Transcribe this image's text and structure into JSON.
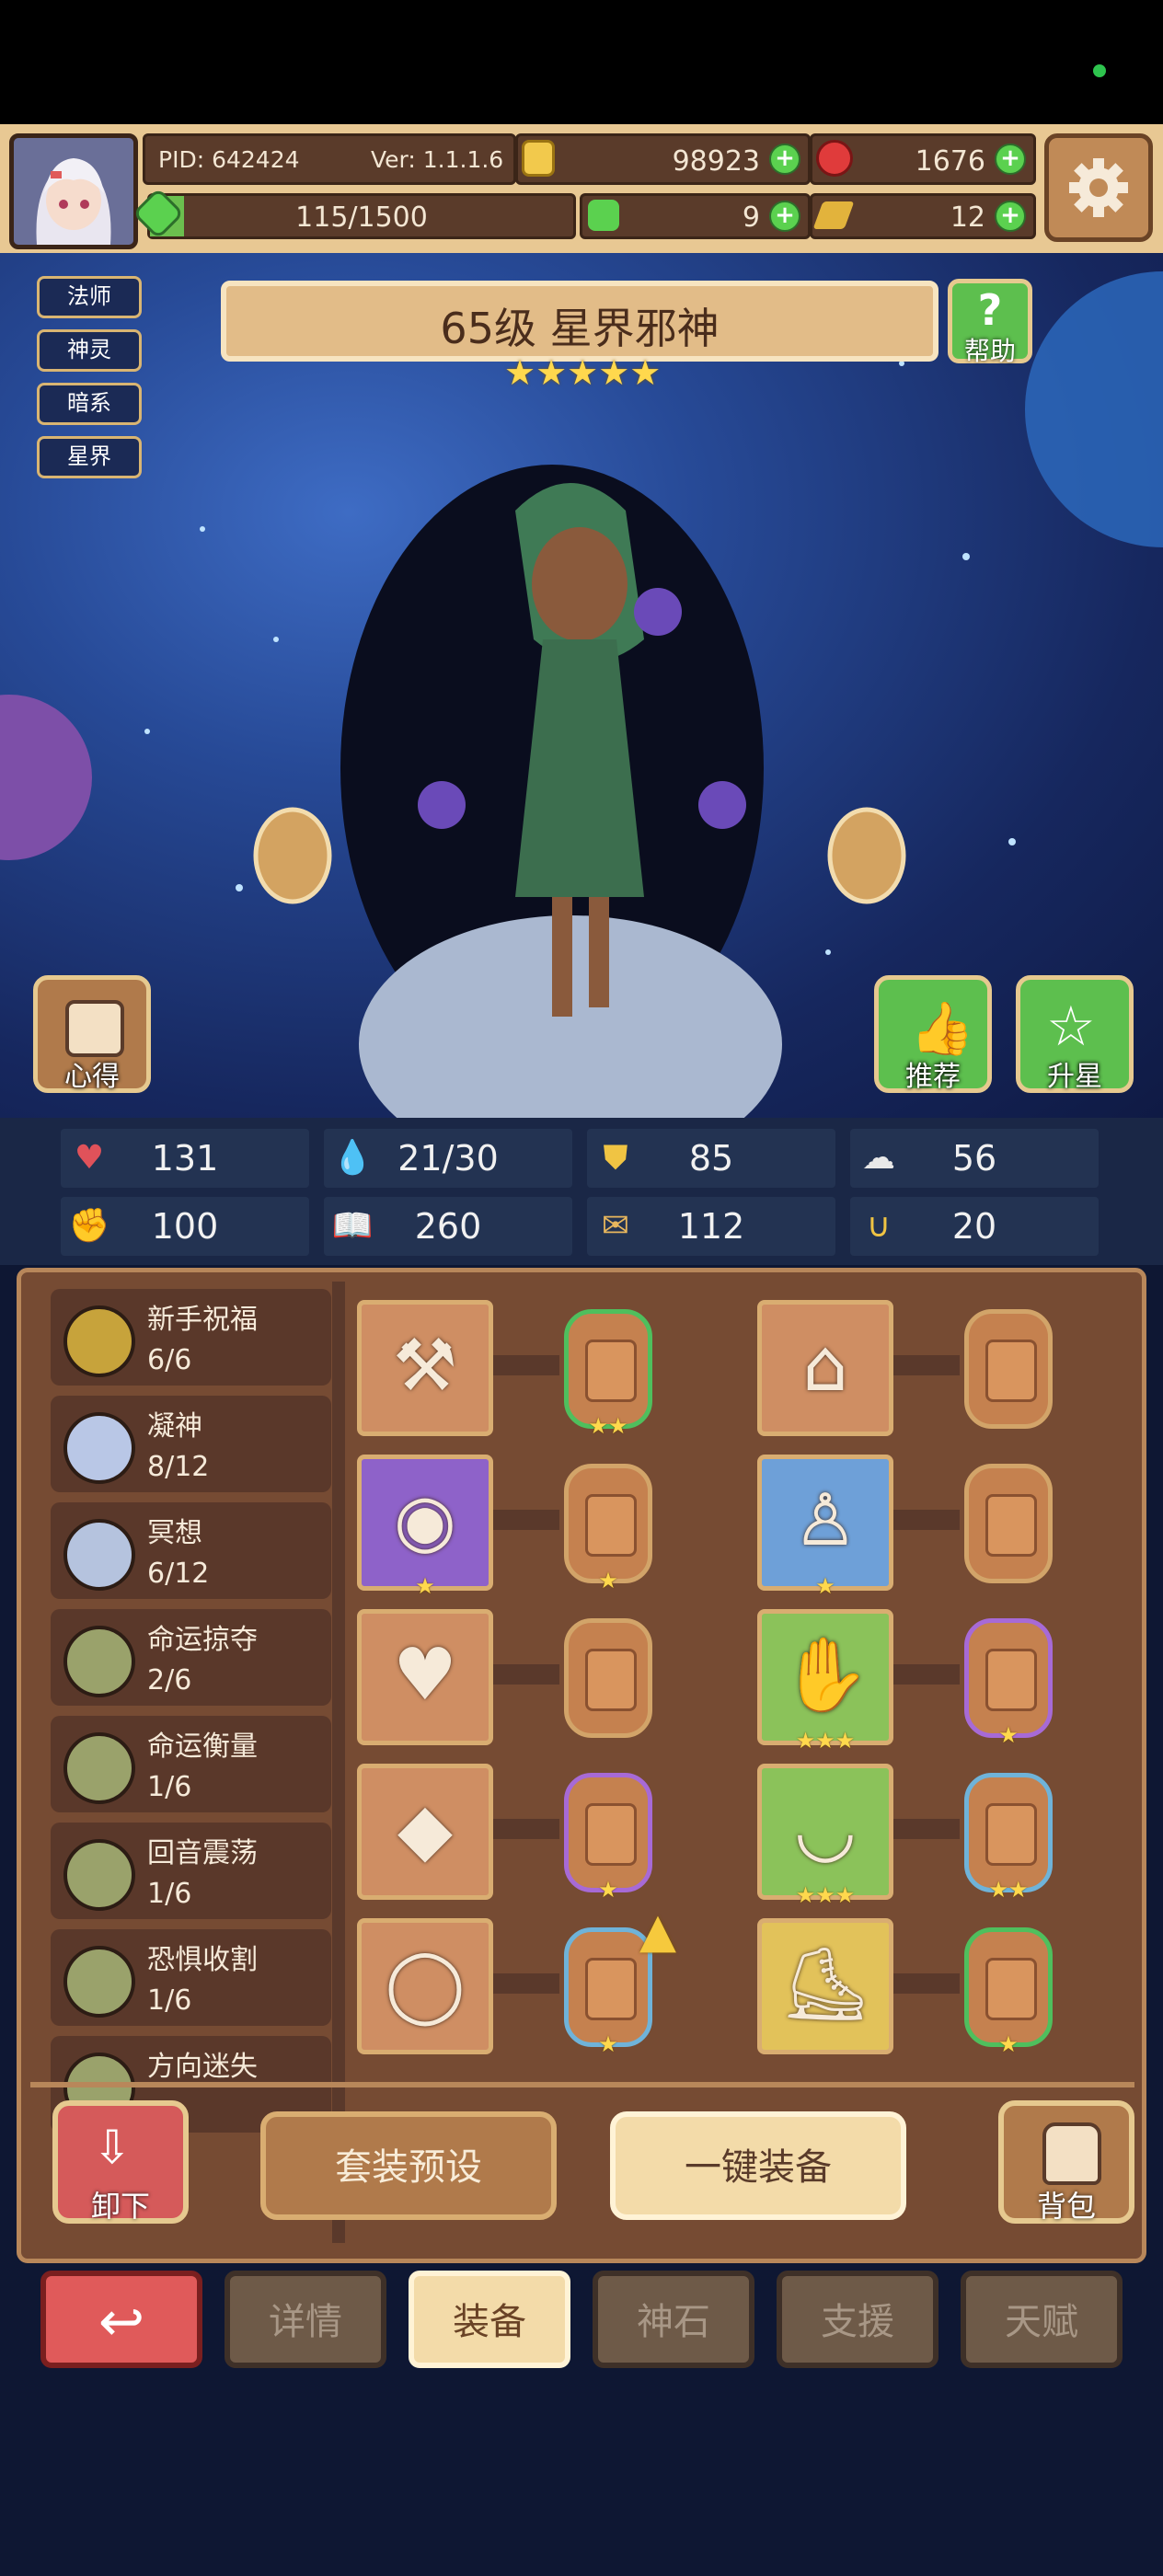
{
  "header": {
    "pid_label": "PID: 642424",
    "version_label": "Ver: 1.1.1.6",
    "gold": "98923",
    "gems": "1676",
    "energy": "115/1500",
    "clover": "9",
    "key": "12"
  },
  "scene": {
    "tags": [
      "法师",
      "神灵",
      "暗系",
      "星界"
    ],
    "title": "65级 星界邪神",
    "star_rating": 5,
    "stars_text": "★★★★★",
    "help_label": "帮助",
    "insight_label": "心得",
    "recommend_label": "推荐",
    "upgrade_label": "升星"
  },
  "stats": [
    {
      "icon": "heart-icon",
      "value": "131",
      "color": "#e0525a"
    },
    {
      "icon": "mana-drop-icon",
      "value": "21/30",
      "color": "#a9dcff"
    },
    {
      "icon": "shield-icon",
      "value": "85",
      "color": "#f0c443"
    },
    {
      "icon": "wing-icon",
      "value": "56",
      "color": "#e8e8e8"
    },
    {
      "icon": "fist-icon",
      "value": "100",
      "color": "#f1a7a0"
    },
    {
      "icon": "spellbook-icon",
      "value": "260",
      "color": "#ffffff"
    },
    {
      "icon": "scroll-icon",
      "value": "112",
      "color": "#e8b75d"
    },
    {
      "icon": "horseshoe-icon",
      "value": "20",
      "color": "#f0c443"
    }
  ],
  "sets": [
    {
      "name": "新手祝福",
      "count": "6/6",
      "icon_color": "#c7a33b"
    },
    {
      "name": "凝神",
      "count": "8/12",
      "icon_color": "#b9c7e6"
    },
    {
      "name": "冥想",
      "count": "6/12",
      "icon_color": "#b5c3de"
    },
    {
      "name": "命运掠夺",
      "count": "2/6",
      "icon_color": "#9aa26b"
    },
    {
      "name": "命运衡量",
      "count": "1/6",
      "icon_color": "#9aa26b"
    },
    {
      "name": "回音震荡",
      "count": "1/6",
      "icon_color": "#9aa26b"
    },
    {
      "name": "恐惧收割",
      "count": "1/6",
      "icon_color": "#9aa26b"
    },
    {
      "name": "方向迷失",
      "count": "",
      "icon_color": "#9aa26b"
    }
  ],
  "equipment": {
    "left": [
      {
        "item": "war-axe-icon",
        "slot_color": "#cf8e63",
        "item_stars": "",
        "rune_border": "#4fbf5d",
        "rune_stars": "★★"
      },
      {
        "item": "dark-orb-icon",
        "slot_color": "#8e62c9",
        "item_stars": "★",
        "rune_border": "#d2a469",
        "rune_stars": "★"
      },
      {
        "item": "heart-amulet-icon",
        "slot_color": "#cf8e63",
        "item_stars": "",
        "rune_border": "#d2a469",
        "rune_stars": ""
      },
      {
        "item": "fire-crystal-icon",
        "slot_color": "#cf8e63",
        "item_stars": "",
        "rune_border": "#a76ad6",
        "rune_stars": "★"
      },
      {
        "item": "gold-ring-icon",
        "slot_color": "#cf8e63",
        "item_stars": "",
        "rune_border": "#6fb3d9",
        "rune_stars": "★"
      }
    ],
    "right": [
      {
        "item": "hood-icon",
        "slot_color": "#cf8e63",
        "item_stars": "",
        "rune_border": "#d2a469",
        "rune_stars": ""
      },
      {
        "item": "white-dress-icon",
        "slot_color": "#6ea0d8",
        "item_stars": "★",
        "rune_border": "#d2a469",
        "rune_stars": ""
      },
      {
        "item": "gauntlet-icon",
        "slot_color": "#8bc25a",
        "item_stars": "★★★",
        "rune_border": "#a76ad6",
        "rune_stars": "★"
      },
      {
        "item": "belt-icon",
        "slot_color": "#8bc25a",
        "item_stars": "★★★",
        "rune_border": "#6fb3d9",
        "rune_stars": "★★"
      },
      {
        "item": "boots-icon",
        "slot_color": "#e2c25a",
        "item_stars": "",
        "rune_border": "#4fbf5d",
        "rune_stars": "★"
      }
    ]
  },
  "actions": {
    "unequip_label": "卸下",
    "preset_label": "套装预设",
    "auto_equip_label": "一键装备",
    "bag_label": "背包"
  },
  "tabs": [
    "详情",
    "装备",
    "神石",
    "支援",
    "天赋"
  ],
  "active_tab": "装备",
  "colors": {
    "accent_gold": "#e8c893",
    "panel_brown": "#764b33",
    "back_red": "#e05a5a"
  }
}
